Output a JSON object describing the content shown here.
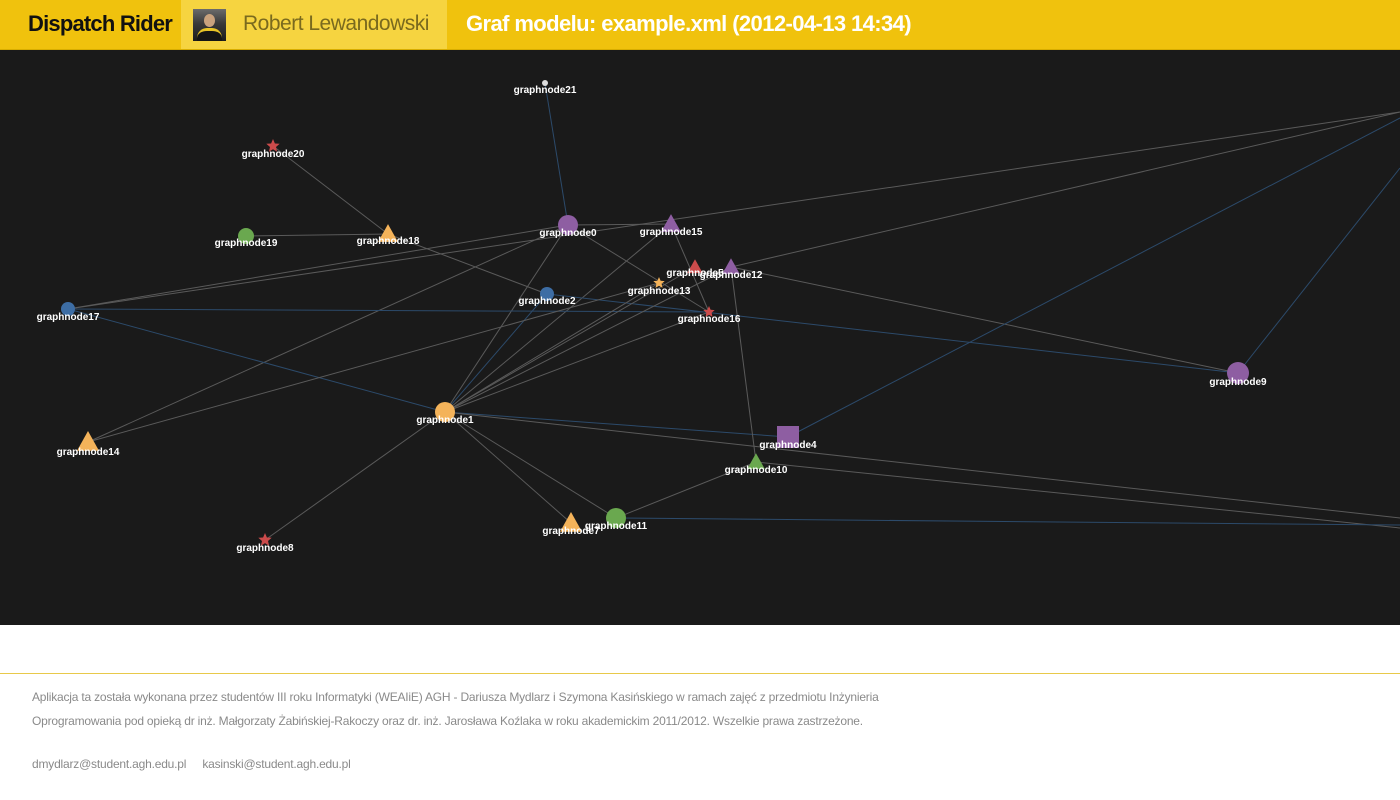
{
  "header": {
    "brand": "Dispatch Rider",
    "user_name": "Robert Lewandowski",
    "page_title": "Graf modelu: example.xml (2012-04-13 14:34)"
  },
  "graph": {
    "colors": {
      "background": "#1a1a1a",
      "purple": "#8e5ea2",
      "orange": "#f4b35a",
      "red": "#cc4b4b",
      "green": "#6aa84f",
      "blue": "#3d6da4",
      "white": "#dddddd",
      "edge_grey": "#5a5a5a",
      "edge_blue": "#2c4a6a"
    },
    "nodes": [
      {
        "id": "graphnode0",
        "label": "graphnode0",
        "shape": "circle",
        "color": "purple"
      },
      {
        "id": "graphnode1",
        "label": "graphnode1",
        "shape": "circle",
        "color": "orange"
      },
      {
        "id": "graphnode2",
        "label": "graphnode2",
        "shape": "circle",
        "color": "blue"
      },
      {
        "id": "graphnode4",
        "label": "graphnode4",
        "shape": "square",
        "color": "purple"
      },
      {
        "id": "graphnode5",
        "label": "graphnode5",
        "shape": "triangle",
        "color": "red"
      },
      {
        "id": "graphnode7",
        "label": "graphnode7",
        "shape": "triangle",
        "color": "orange"
      },
      {
        "id": "graphnode8",
        "label": "graphnode8",
        "shape": "star",
        "color": "red"
      },
      {
        "id": "graphnode9",
        "label": "graphnode9",
        "shape": "circle",
        "color": "purple"
      },
      {
        "id": "graphnode10",
        "label": "graphnode10",
        "shape": "triangle",
        "color": "green"
      },
      {
        "id": "graphnode11",
        "label": "graphnode11",
        "shape": "circle",
        "color": "green"
      },
      {
        "id": "graphnode12",
        "label": "graphnode12",
        "shape": "triangle",
        "color": "purple"
      },
      {
        "id": "graphnode13",
        "label": "graphnode13",
        "shape": "star",
        "color": "orange"
      },
      {
        "id": "graphnode14",
        "label": "graphnode14",
        "shape": "triangle",
        "color": "orange"
      },
      {
        "id": "graphnode15",
        "label": "graphnode15",
        "shape": "triangle",
        "color": "purple"
      },
      {
        "id": "graphnode16",
        "label": "graphnode16",
        "shape": "star",
        "color": "red"
      },
      {
        "id": "graphnode17",
        "label": "graphnode17",
        "shape": "circle",
        "color": "blue"
      },
      {
        "id": "graphnode18",
        "label": "graphnode18",
        "shape": "triangle",
        "color": "orange"
      },
      {
        "id": "graphnode19",
        "label": "graphnode19",
        "shape": "circle",
        "color": "green"
      },
      {
        "id": "graphnode20",
        "label": "graphnode20",
        "shape": "star",
        "color": "red"
      },
      {
        "id": "graphnode21",
        "label": "graphnode21",
        "shape": "dot",
        "color": "white"
      }
    ],
    "edges": [
      {
        "from": "graphnode21",
        "to": "graphnode0",
        "color": "edge_blue"
      },
      {
        "from": "graphnode20",
        "to": "graphnode18",
        "color": "edge_grey"
      },
      {
        "from": "graphnode19",
        "to": "graphnode18",
        "color": "edge_grey"
      },
      {
        "from": "graphnode18",
        "to": "graphnode2",
        "color": "edge_grey"
      },
      {
        "from": "graphnode0",
        "to": "graphnode15",
        "color": "edge_grey"
      },
      {
        "from": "graphnode0",
        "to": "graphnode17",
        "color": "edge_grey"
      },
      {
        "from": "graphnode0",
        "to": "graphnode1",
        "color": "edge_grey"
      },
      {
        "from": "graphnode0",
        "to": "graphnode16",
        "color": "edge_grey"
      },
      {
        "from": "graphnode0",
        "to": "graphnode14",
        "color": "edge_grey"
      },
      {
        "from": "graphnode15",
        "to": "graphnode16",
        "color": "edge_grey"
      },
      {
        "from": "graphnode15",
        "to": "graphnode1",
        "color": "edge_grey"
      },
      {
        "from": "graphnode17",
        "to": "graphnode16",
        "color": "edge_blue"
      },
      {
        "from": "graphnode17",
        "to": "graphnode1",
        "color": "edge_blue"
      },
      {
        "from": "graphnode2",
        "to": "graphnode1",
        "color": "edge_blue"
      },
      {
        "from": "graphnode2",
        "to": "graphnode9",
        "color": "edge_blue"
      },
      {
        "from": "graphnode12",
        "to": "graphnode9",
        "color": "edge_grey"
      },
      {
        "from": "graphnode13",
        "to": "graphnode1",
        "color": "edge_grey"
      },
      {
        "from": "graphnode13",
        "to": "graphnode14",
        "color": "edge_grey"
      },
      {
        "from": "graphnode12",
        "to": "graphnode1",
        "color": "edge_grey"
      },
      {
        "from": "graphnode16",
        "to": "graphnode1",
        "color": "edge_grey"
      },
      {
        "from": "graphnode5",
        "to": "graphnode1",
        "color": "edge_grey"
      },
      {
        "from": "graphnode1",
        "to": "graphnode8",
        "color": "edge_grey"
      },
      {
        "from": "graphnode1",
        "to": "graphnode7",
        "color": "edge_grey"
      },
      {
        "from": "graphnode1",
        "to": "graphnode11",
        "color": "edge_grey"
      },
      {
        "from": "graphnode1",
        "to": "graphnode4",
        "color": "edge_blue"
      },
      {
        "from": "graphnode11",
        "to": "graphnode10",
        "color": "edge_grey"
      },
      {
        "from": "graphnode10",
        "to": "graphnode12",
        "color": "edge_grey"
      },
      {
        "from": "graphnode1",
        "to": "offscreen_br1",
        "color": "edge_grey"
      },
      {
        "from": "graphnode10",
        "to": "offscreen_br2",
        "color": "edge_grey"
      },
      {
        "from": "graphnode11",
        "to": "offscreen_br3",
        "color": "edge_blue"
      },
      {
        "from": "graphnode17",
        "to": "offscreen_tr1",
        "color": "edge_grey"
      },
      {
        "from": "graphnode12",
        "to": "offscreen_tr1",
        "color": "edge_grey"
      },
      {
        "from": "graphnode4",
        "to": "offscreen_tr2",
        "color": "edge_blue"
      },
      {
        "from": "graphnode9",
        "to": "offscreen_tr3",
        "color": "edge_blue"
      }
    ]
  },
  "footer": {
    "line1": "Aplikacja ta została wykonana przez studentów III roku Informatyki  (WEAIiE) AGH - Dariusza Mydlarz i Szymona Kasińskiego w ramach zajęć z przedmiotu Inżynieria",
    "line2": "Oprogramowania pod opieką dr inż.  Małgorzaty Żabińskiej-Rakoczy oraz dr. inż. Jarosława Koźlaka w roku akademickim 2011/2012. Wszelkie prawa zastrzeżone.",
    "email1": "dmydlarz@student.agh.edu.pl",
    "email2": "kasinski@student.agh.edu.pl"
  }
}
